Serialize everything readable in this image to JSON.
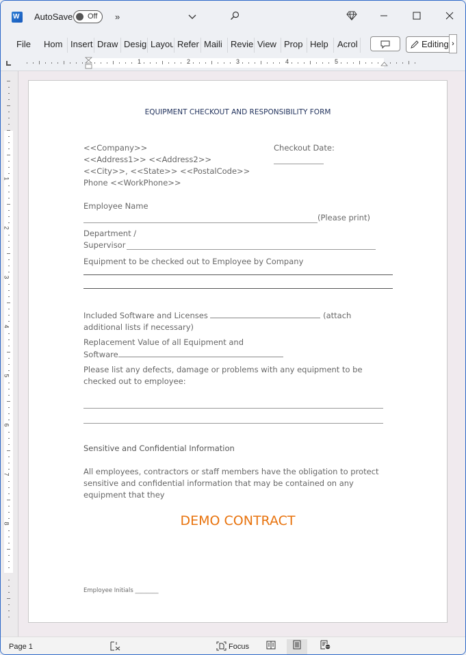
{
  "titlebar": {
    "app_icon": "word-icon",
    "autosave_label": "AutoSave",
    "autosave_state": "Off",
    "more_commands": "»",
    "customize_icon": "chevron-down-icon",
    "search_icon": "search-icon",
    "premium_icon": "diamond-icon",
    "minimize": "—",
    "maximize": "☐",
    "close": "✕"
  },
  "ribbon": {
    "tabs": [
      "File",
      "Home",
      "Insert",
      "Draw",
      "Design",
      "Layout",
      "References",
      "Mailings",
      "Review",
      "View",
      "Properties",
      "Help",
      "Acrobat"
    ],
    "tabs_visible": [
      "File",
      "Hom ",
      "Insert",
      "Draw",
      "Desig",
      "Layou",
      "Refer",
      "Maili",
      "Revie",
      "View",
      "Prop ",
      "Help",
      "Acrol"
    ],
    "comment_icon": "comment-icon",
    "editing_label": "Editing",
    "more_label": "›"
  },
  "ruler": {
    "h_numbers": [
      "1",
      "2",
      "3",
      "4",
      "5"
    ],
    "v_numbers": [
      "1",
      "2",
      "3",
      "4",
      "5",
      "6",
      "7",
      "8"
    ]
  },
  "document": {
    "title": "EQUIPMENT CHECKOUT AND RESPONSIBILITY FORM",
    "address": {
      "company": "<<Company>>",
      "address": "<<Address1>> <<Address2>>",
      "city_state_zip": "<<City>>, <<State>> <<PostalCode>>",
      "phone": "Phone <<WorkPhone>>"
    },
    "checkout_date_label": "Checkout Date:",
    "employee_name_label": "Employee Name",
    "please_print": "(Please print)",
    "department_label_1": "Department /",
    "department_label_2": "Supervisor",
    "equipment_label": "Equipment to be checked out to Employee by Company",
    "software_label": "Included Software and Licenses",
    "software_suffix": "(attach",
    "software_line2": "additional lists if necessary)",
    "replacement_label_1": "Replacement Value of all Equipment and",
    "replacement_label_2": "Software",
    "defects_label_1": "Please list any defects, damage or problems with any equipment to be",
    "defects_label_2": "checked out to employee:",
    "sensitive_heading": "Sensitive and Confidential Information",
    "sensitive_body_1": "All employees, contractors or staff members have the obligation to protect",
    "sensitive_body_2": "sensitive and confidential information that may be contained on any",
    "sensitive_body_3": "equipment that they",
    "demo_watermark": "DEMO CONTRACT",
    "initials_label": "Employee Initials ________",
    "demo_color": "#e8720c",
    "title_color": "#1e2f5a"
  },
  "statusbar": {
    "page": "Page 1",
    "proofing_icon": "proofing-icon",
    "focus_label": "Focus",
    "read_mode_icon": "read-mode-icon",
    "print_layout_icon": "print-layout-icon",
    "web_layout_icon": "web-layout-icon"
  }
}
